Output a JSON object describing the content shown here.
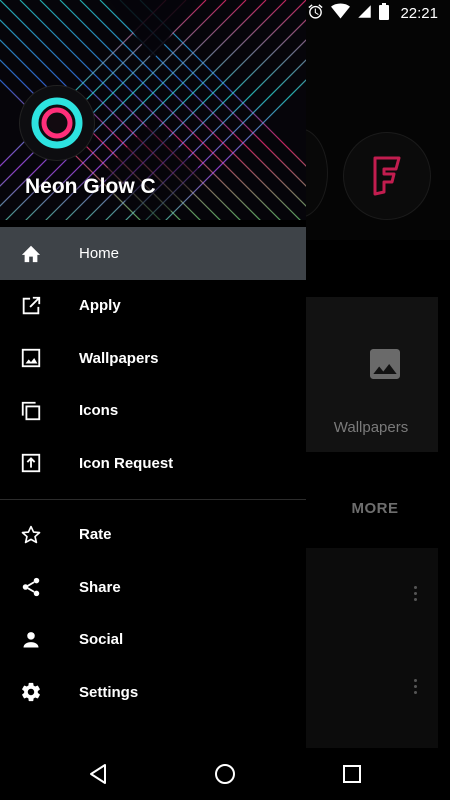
{
  "status_bar": {
    "time": "22:21"
  },
  "drawer": {
    "app_name": "Neon Glow C",
    "primary_items": [
      {
        "label": "Home",
        "icon": "home-icon",
        "active": true
      },
      {
        "label": "Apply",
        "icon": "open-external-icon"
      },
      {
        "label": "Wallpapers",
        "icon": "image-icon"
      },
      {
        "label": "Icons",
        "icon": "copy-icon"
      },
      {
        "label": "Icon Request",
        "icon": "upload-box-icon"
      }
    ],
    "secondary_items": [
      {
        "label": "Rate",
        "icon": "star-icon"
      },
      {
        "label": "Share",
        "icon": "share-icon"
      },
      {
        "label": "Social",
        "icon": "person-icon"
      },
      {
        "label": "Settings",
        "icon": "gear-icon"
      }
    ]
  },
  "background": {
    "wallpapers_label": "Wallpapers",
    "more_label": "MORE"
  },
  "colors": {
    "active_item_bg": "#3e4348",
    "neon_cyan": "#2de3e0",
    "neon_pink": "#ff2f7a",
    "foursquare_pink": "#c21d4f"
  }
}
